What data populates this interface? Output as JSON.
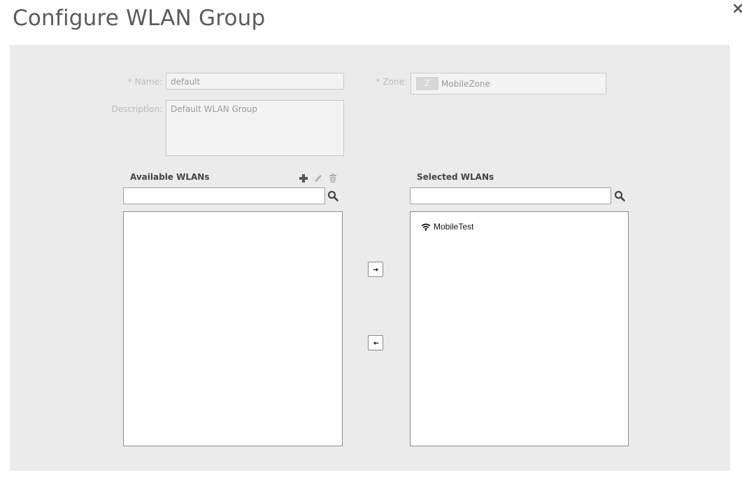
{
  "dialog": {
    "title": "Configure WLAN Group",
    "close_label": "×"
  },
  "form": {
    "name_label": "Name:",
    "name_value": "default",
    "zone_label": "Zone:",
    "zone_badge": "Z",
    "zone_value": "MobileZone",
    "description_label": "Description:",
    "description_value": "Default WLAN Group",
    "required_marker": "*"
  },
  "available": {
    "title": "Available WLANs",
    "search_value": "",
    "items": []
  },
  "selected": {
    "title": "Selected WLANs",
    "search_value": "",
    "items": [
      {
        "label": "MobileTest",
        "icon": "wifi-icon"
      }
    ]
  },
  "icons": {
    "add": "plus-icon",
    "edit": "pencil-icon",
    "delete": "trash-icon",
    "search": "search-icon",
    "move_right": "arrow-right-icon",
    "move_left": "arrow-left-icon"
  },
  "colors": {
    "panel_bg": "#ebebeb",
    "required": "#f0b07a",
    "title": "#5b5b5b"
  }
}
